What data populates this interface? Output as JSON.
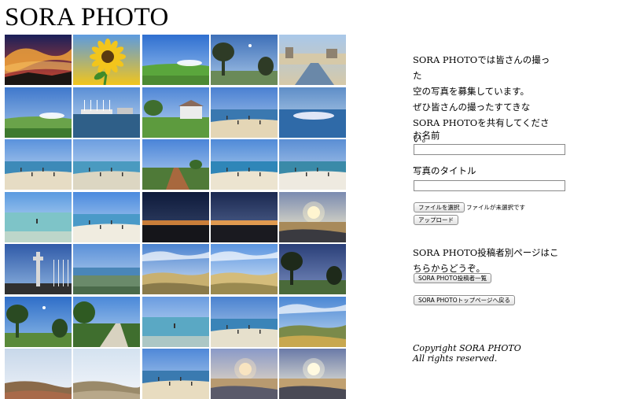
{
  "site": {
    "title": "SORA PHOTO"
  },
  "gallery": {
    "photos": [
      {
        "name": "photo-sunset-clouds",
        "kind": "sunset",
        "colors": [
          "#1a1f5a",
          "#d2462a",
          "#f0a23a",
          "#1b1512"
        ]
      },
      {
        "name": "photo-sunflower",
        "kind": "sunflower",
        "colors": [
          "#5c9be0",
          "#f2c51c",
          "#3f8b2a",
          "#c9e0f5"
        ]
      },
      {
        "name": "photo-blue-sky-lawn",
        "kind": "skyground",
        "colors": [
          "#2f6fd0",
          "#9dc4f0",
          "#5aa63c",
          "#4c8a32"
        ]
      },
      {
        "name": "photo-tree-moon",
        "kind": "tree",
        "colors": [
          "#3d6fb8",
          "#a9c7e8",
          "#2e3b26",
          "#6a8a58"
        ]
      },
      {
        "name": "photo-river-town",
        "kind": "town",
        "colors": [
          "#a9c8ea",
          "#d6c9a8",
          "#6a88a8",
          "#8e8270"
        ]
      },
      {
        "name": "photo-park-fountain",
        "kind": "skyground",
        "colors": [
          "#3f78cc",
          "#a5c6ea",
          "#6aa34a",
          "#3f7a2e"
        ]
      },
      {
        "name": "photo-harbor-boats",
        "kind": "harbor",
        "colors": [
          "#5a8fd6",
          "#c8dcf0",
          "#2f5f88",
          "#e8e8e8"
        ]
      },
      {
        "name": "photo-house-lawn",
        "kind": "house",
        "colors": [
          "#4f86d6",
          "#bcd6f2",
          "#5d9b3e",
          "#ececec"
        ]
      },
      {
        "name": "photo-beach-blue",
        "kind": "beach",
        "colors": [
          "#4a80d2",
          "#b4d0ee",
          "#3a78b0",
          "#e4d6b6"
        ]
      },
      {
        "name": "photo-sea-glare",
        "kind": "glare",
        "colors": [
          "#5e8ec8",
          "#c8dcf0",
          "#2f6aa8",
          "#f4f4ff"
        ]
      },
      {
        "name": "photo-beach-people",
        "kind": "beach",
        "colors": [
          "#5a92dc",
          "#d0e2f4",
          "#3d8ab8",
          "#e6dcc4"
        ]
      },
      {
        "name": "photo-shore-walk",
        "kind": "beach",
        "colors": [
          "#6c9ee0",
          "#d2e4f6",
          "#4a9ac0",
          "#dcd6c2"
        ]
      },
      {
        "name": "photo-red-dirt-road",
        "kind": "road",
        "colors": [
          "#4a84d8",
          "#bcd6f2",
          "#a8683e",
          "#4f7a38"
        ]
      },
      {
        "name": "photo-beach-crowd",
        "kind": "beach",
        "colors": [
          "#4f8ad8",
          "#c4dcf2",
          "#2f86b8",
          "#ece4d0"
        ]
      },
      {
        "name": "photo-white-sand-sea",
        "kind": "beach",
        "colors": [
          "#5a8ed4",
          "#c4d8f0",
          "#3a8aa8",
          "#eeeae0"
        ]
      },
      {
        "name": "photo-shallow-water",
        "kind": "shallow",
        "colors": [
          "#5a9ae0",
          "#d6e8f8",
          "#7ec4c8",
          "#e8e2cc"
        ]
      },
      {
        "name": "photo-people-beach",
        "kind": "beach",
        "colors": [
          "#4a8ade",
          "#c8def4",
          "#4a9ac8",
          "#f0ece0"
        ]
      },
      {
        "name": "photo-dark-dusk",
        "kind": "dusk",
        "colors": [
          "#0e1a3a",
          "#3a4a70",
          "#c97e3a",
          "#15151a"
        ]
      },
      {
        "name": "photo-dusk-horizon",
        "kind": "dusk",
        "colors": [
          "#1a2850",
          "#5a6e9a",
          "#e09a50",
          "#1a1a20"
        ]
      },
      {
        "name": "photo-sun-sea",
        "kind": "sunsea",
        "colors": [
          "#7a8ab0",
          "#fff6d0",
          "#a88a5a",
          "#3a3a40"
        ]
      },
      {
        "name": "photo-tower",
        "kind": "tower",
        "colors": [
          "#2f5aa8",
          "#8fb4e0",
          "#d8d8d8",
          "#303030"
        ]
      },
      {
        "name": "photo-wide-coast",
        "kind": "coast",
        "colors": [
          "#5a90d8",
          "#c4daf2",
          "#6a8a6a",
          "#4a6a4a"
        ]
      },
      {
        "name": "photo-clouds-dunes",
        "kind": "dunes",
        "colors": [
          "#4a82d0",
          "#dce8f6",
          "#c8b070",
          "#8a7a4a"
        ]
      },
      {
        "name": "photo-dunes-grass",
        "kind": "dunes",
        "colors": [
          "#5a94e0",
          "#e0ecf8",
          "#d4bc7a",
          "#9a8a50"
        ]
      },
      {
        "name": "photo-palm-dusk",
        "kind": "palm",
        "colors": [
          "#2a3f78",
          "#7a8ec0",
          "#1e2a1a",
          "#4a6a3a"
        ]
      },
      {
        "name": "photo-trees-lake",
        "kind": "tree",
        "colors": [
          "#2f6ec8",
          "#8fbce8",
          "#2a4a22",
          "#5a8a3a"
        ]
      },
      {
        "name": "photo-path-trees",
        "kind": "path",
        "colors": [
          "#4a88d8",
          "#b8d4f0",
          "#3f6e2e",
          "#d8d2c0"
        ]
      },
      {
        "name": "photo-beach-birds",
        "kind": "shallow",
        "colors": [
          "#6a9ce0",
          "#d4e6f6",
          "#5aa8c4",
          "#e2dcc6"
        ]
      },
      {
        "name": "photo-sea-wide",
        "kind": "beach",
        "colors": [
          "#4a82d0",
          "#bcd4ee",
          "#3a84b8",
          "#e6e0cc"
        ]
      },
      {
        "name": "photo-shrubs-coast",
        "kind": "shrubs",
        "colors": [
          "#4a86d4",
          "#c4dcf2",
          "#7a8a4a",
          "#c8a850"
        ]
      },
      {
        "name": "photo-pale-sky-hill",
        "kind": "hill",
        "colors": [
          "#c8d8ea",
          "#eef2f8",
          "#8a6a4a",
          "#a86a4a"
        ]
      },
      {
        "name": "photo-pale-sky",
        "kind": "hill",
        "colors": [
          "#d4e2f0",
          "#f4f6fa",
          "#9a8a6a",
          "#b8a88a"
        ]
      },
      {
        "name": "photo-blue-sea-sand",
        "kind": "beach",
        "colors": [
          "#4f88d8",
          "#c0d8f0",
          "#3a7ab0",
          "#e8dcc0"
        ]
      },
      {
        "name": "photo-sunset-sea",
        "kind": "sunsea",
        "colors": [
          "#8a9ac8",
          "#f8e4c0",
          "#b89a70",
          "#5a5a6a"
        ]
      },
      {
        "name": "photo-bright-sun",
        "kind": "sunsea",
        "colors": [
          "#6a7aa8",
          "#fffae0",
          "#c0a070",
          "#4a4a55"
        ]
      }
    ]
  },
  "sidebar": {
    "intro": [
      "SORA PHOTOでは皆さんの撮った",
      "空の写真を募集しています。",
      "ぜひ皆さんの撮ったすてきな",
      "SORA PHOTOを共有してくださ",
      "い。"
    ],
    "name_label": "お名前",
    "name_value": "",
    "title_label": "写真のタイトル",
    "title_value": "",
    "file_button": "ファイルを選択",
    "file_status": "ファイルが未選択です",
    "upload_button": "アップロード",
    "poster_text": [
      "SORA PHOTO投稿者別ページはこ",
      "ちらからどうぞ。"
    ],
    "poster_button": "SORA PHOTO投稿者一覧",
    "top_button": "SORA PHOTOトップページへ戻る",
    "copyright": [
      "Copyright SORA PHOTO",
      "All rights reserved."
    ]
  }
}
